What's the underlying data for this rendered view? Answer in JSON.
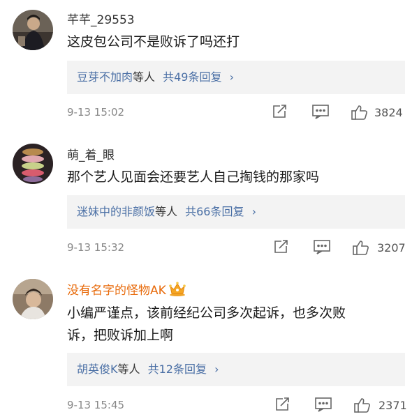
{
  "comments": [
    {
      "username": "芊芊_29553",
      "text": "这皮包公司不是败诉了吗还打",
      "replies": {
        "names": "豆芽不加肉",
        "suffix": "等人",
        "count_text": "共49条回复",
        "chevron": "›"
      },
      "time": "9-13 15:02",
      "likes": "3824"
    },
    {
      "username": "萌_着_眼",
      "text": "那个艺人见面会还要艺人自己掏钱的那家吗",
      "replies": {
        "names": "迷妹中的非颜饭",
        "suffix": "等人",
        "count_text": "共66条回复",
        "chevron": "›"
      },
      "time": "9-13 15:32",
      "likes": "3207"
    },
    {
      "username": "没有名字的怪物AK",
      "text_line1": "小编严谨点，该前经纪公司多次起诉，也多次败",
      "text_line2": "诉，把败诉加上啊",
      "replies": {
        "names": "胡英俊K",
        "suffix": "等人",
        "count_text": "共12条回复",
        "chevron": "›"
      },
      "time": "9-13 15:45",
      "likes": "2371"
    }
  ],
  "colors": {
    "link": "#4a6fa5",
    "vip_name": "#e86b0c",
    "reply_bg": "#f3f3f3"
  },
  "icons": [
    "share-icon",
    "comment-icon",
    "like-icon",
    "crown-icon"
  ]
}
